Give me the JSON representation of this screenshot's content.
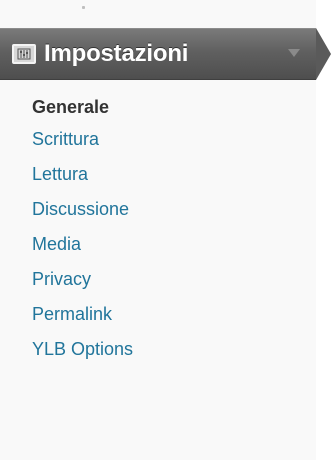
{
  "menu": {
    "section_title": "Impostazioni",
    "section_icon": "settings-panel-icon",
    "items": [
      {
        "label": "Generale",
        "current": true
      },
      {
        "label": "Scrittura",
        "current": false
      },
      {
        "label": "Lettura",
        "current": false
      },
      {
        "label": "Discussione",
        "current": false
      },
      {
        "label": "Media",
        "current": false
      },
      {
        "label": "Privacy",
        "current": false
      },
      {
        "label": "Permalink",
        "current": false
      },
      {
        "label": "YLB Options",
        "current": false
      }
    ]
  },
  "colors": {
    "header_bg": "#606060",
    "link": "#21759b",
    "current_link": "#333333",
    "sidebar_bg": "#f9f9f9"
  }
}
